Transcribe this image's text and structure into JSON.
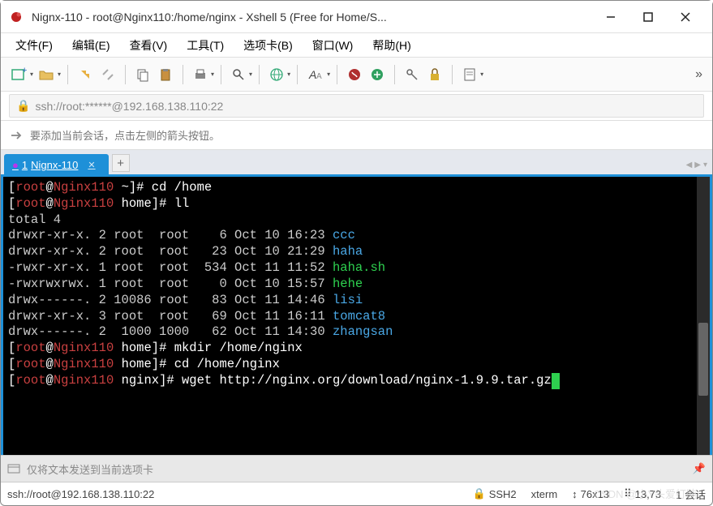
{
  "window": {
    "title": "Nignx-110 - root@Nginx110:/home/nginx - Xshell 5 (Free for Home/S..."
  },
  "menu": {
    "file": "文件(F)",
    "edit": "编辑(E)",
    "view": "查看(V)",
    "tools": "工具(T)",
    "tabs": "选项卡(B)",
    "window": "窗口(W)",
    "help": "帮助(H)"
  },
  "address": {
    "url": "ssh://root:******@192.168.138.110:22"
  },
  "hint": {
    "text": "要添加当前会话，点击左侧的箭头按钮。"
  },
  "tabs": {
    "active": {
      "index": "1",
      "label": "Nignx-110"
    },
    "add": "+"
  },
  "terminal": {
    "lines": [
      {
        "type": "prompt",
        "user": "root",
        "host": "Nginx110",
        "path": "~",
        "cmd": "cd /home"
      },
      {
        "type": "prompt",
        "user": "root",
        "host": "Nginx110",
        "path": "home",
        "cmd": "ll"
      },
      {
        "type": "text",
        "text": "total 4"
      },
      {
        "type": "ls",
        "perm": "drwxr-xr-x.",
        "n": "2",
        "own": "root ",
        "grp": "root ",
        "size": "  6",
        "date": "Oct 10 16:23",
        "name": "ccc",
        "cls": "dir"
      },
      {
        "type": "ls",
        "perm": "drwxr-xr-x.",
        "n": "2",
        "own": "root ",
        "grp": "root ",
        "size": " 23",
        "date": "Oct 10 21:29",
        "name": "haha",
        "cls": "dir"
      },
      {
        "type": "ls",
        "perm": "-rwxr-xr-x.",
        "n": "1",
        "own": "root ",
        "grp": "root ",
        "size": "534",
        "date": "Oct 11 11:52",
        "name": "haha.sh",
        "cls": "exe"
      },
      {
        "type": "ls",
        "perm": "-rwxrwxrwx.",
        "n": "1",
        "own": "root ",
        "grp": "root ",
        "size": "  0",
        "date": "Oct 10 15:57",
        "name": "hehe",
        "cls": "exe"
      },
      {
        "type": "ls",
        "perm": "drwx------.",
        "n": "2",
        "own": "10086",
        "grp": "root ",
        "size": " 83",
        "date": "Oct 11 14:46",
        "name": "lisi",
        "cls": "dir"
      },
      {
        "type": "ls",
        "perm": "drwxr-xr-x.",
        "n": "3",
        "own": "root ",
        "grp": "root ",
        "size": " 69",
        "date": "Oct 11 16:11",
        "name": "tomcat8",
        "cls": "dir"
      },
      {
        "type": "ls",
        "perm": "drwx------.",
        "n": "2",
        "own": " 1000",
        "grp": "1000 ",
        "size": " 62",
        "date": "Oct 11 14:30",
        "name": "zhangsan",
        "cls": "dir"
      },
      {
        "type": "prompt",
        "user": "root",
        "host": "Nginx110",
        "path": "home",
        "cmd": "mkdir /home/nginx"
      },
      {
        "type": "prompt",
        "user": "root",
        "host": "Nginx110",
        "path": "home",
        "cmd": "cd /home/nginx"
      },
      {
        "type": "prompt",
        "user": "root",
        "host": "Nginx110",
        "path": "nginx",
        "cmd": "wget http://nginx.org/download/nginx-1.9.9.tar.gz",
        "cursor": true
      }
    ]
  },
  "sendbar": {
    "placeholder": "仅将文本发送到当前选项卡"
  },
  "status": {
    "conn": "ssh://root@192.168.138.110:22",
    "ssh": "SSH2",
    "term": "xterm",
    "size": "76x13",
    "pos": "13,73",
    "sess": "1 会话"
  },
  "watermark": "CSDN @小Y头爱打盹"
}
